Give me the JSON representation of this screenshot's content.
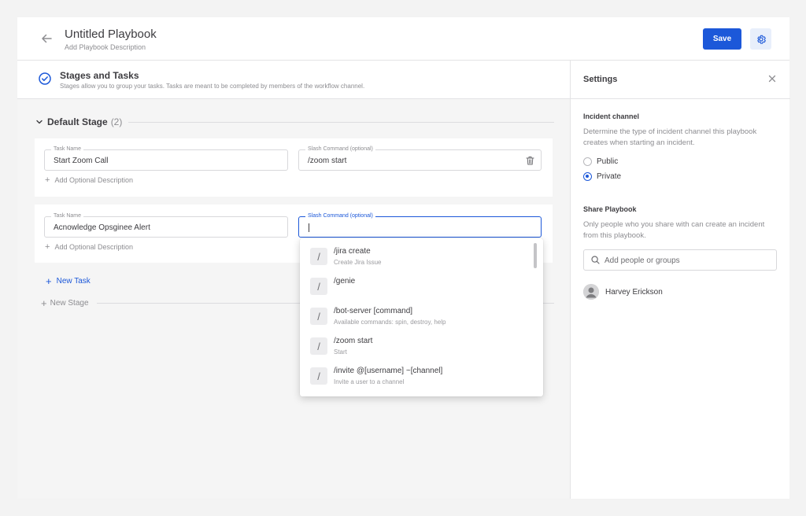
{
  "header": {
    "title": "Untitled Playbook",
    "subtitle": "Add Playbook Description",
    "save_label": "Save"
  },
  "stages_bar": {
    "title": "Stages and Tasks",
    "description": "Stages allow you to group your tasks. Tasks are meant to be completed by members of the workflow channel."
  },
  "stage": {
    "name": "Default Stage",
    "count": "(2)"
  },
  "tasks": [
    {
      "name_label": "Task Name",
      "name_value": "Start Zoom Call",
      "command_label": "Slash Command (optional)",
      "command_value": "/zoom start",
      "add_description": "Add Optional Description"
    },
    {
      "name_label": "Task Name",
      "name_value": "Acnowledge Opsginee Alert",
      "command_label": "Slash Command (optional)",
      "command_value": "",
      "add_description": "Add Optional Description"
    }
  ],
  "new_task_label": "New Task",
  "new_stage_label": "New Stage",
  "command_dropdown": [
    {
      "name": "/jira create",
      "hint": "Create Jira Issue"
    },
    {
      "name": "/genie",
      "hint": ""
    },
    {
      "name": "/bot-server [command]",
      "hint": "Available commands: spin, destroy, help"
    },
    {
      "name": "/zoom start",
      "hint": "Start"
    },
    {
      "name": "/invite @[username] ~[channel]",
      "hint": "Invite a user to a channel"
    }
  ],
  "settings": {
    "title": "Settings",
    "incident_channel": {
      "title": "Incident channel",
      "description": "Determine the type of incident channel this playbook creates when starting an incident.",
      "options": [
        "Public",
        "Private"
      ],
      "selected": "Private"
    },
    "share": {
      "title": "Share Playbook",
      "description": "Only people who you share with can create an incident from this playbook.",
      "search_placeholder": "Add people or groups",
      "users": [
        "Harvey Erickson"
      ]
    }
  },
  "colors": {
    "accent": "#1c58d9",
    "background": "#f3f3f3",
    "text": "#3d3c40",
    "muted": "#8d8d91"
  }
}
